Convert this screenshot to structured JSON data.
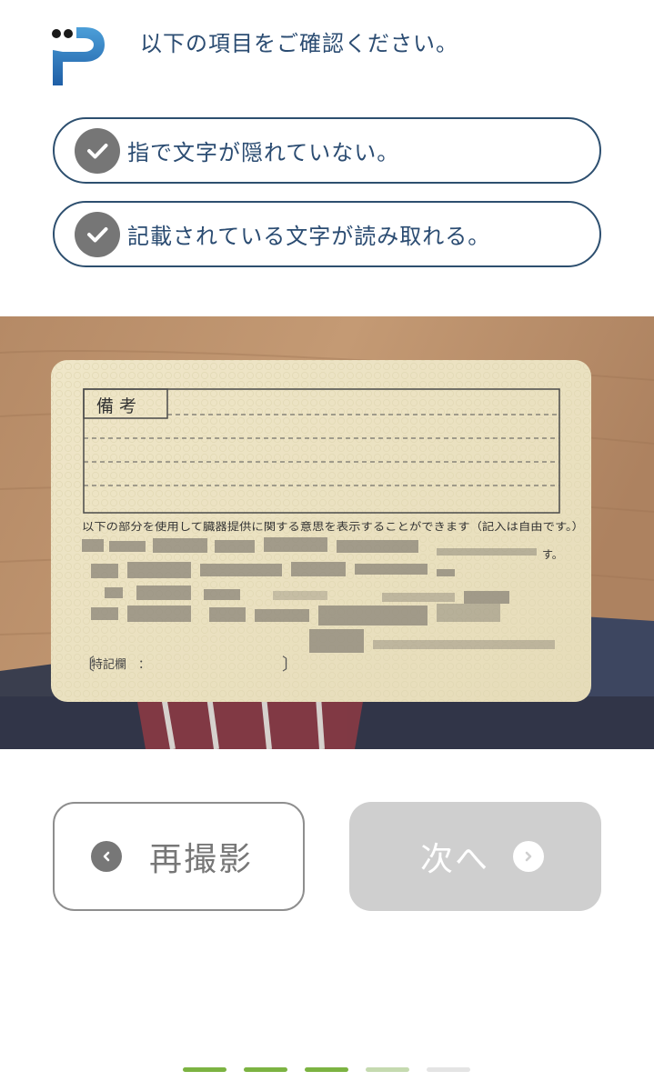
{
  "header": {
    "instruction": "以下の項目をご確認ください。"
  },
  "checklist": [
    {
      "label": "指で文字が隠れていない。",
      "checked": true
    },
    {
      "label": "記載されている文字が読み取れる。",
      "checked": true
    }
  ],
  "card": {
    "remarks_label": "備 考",
    "donation_notice": "以下の部分を使用して臓器提供に関する意思を表示することができます（記入は自由です。）",
    "notes_label": "特記欄　：",
    "sentence_end": "す。"
  },
  "buttons": {
    "retake_label": "再撮影",
    "next_label": "次へ",
    "next_enabled": false
  },
  "progress": {
    "step_colors": [
      "#7cb342",
      "#7cb342",
      "#7cb342",
      "#c5dab0",
      "#e4e4e4"
    ]
  },
  "colors": {
    "accent": "#2b4c72",
    "check_gray": "#767676",
    "disabled_button": "#cfcfcf"
  }
}
